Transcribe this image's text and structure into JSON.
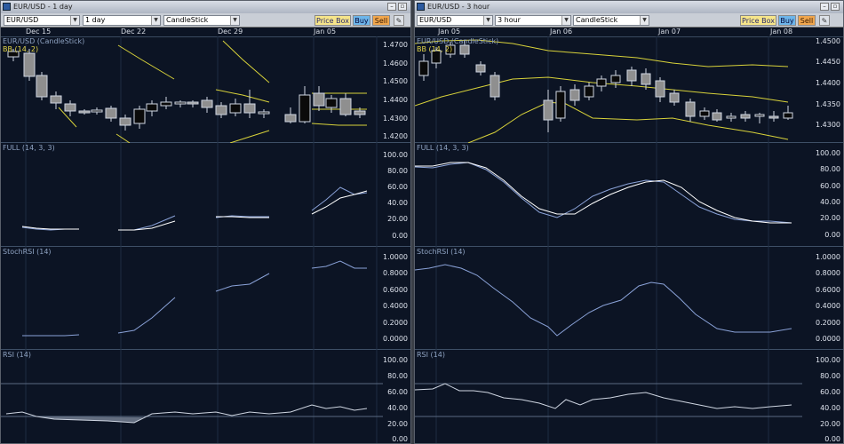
{
  "windows": [
    {
      "title": "EUR/USD - 1 day",
      "symbol": "EUR/USD",
      "period": "1 day",
      "style": "CandleStick",
      "price_box": "Price Box",
      "buy": "Buy",
      "sell": "Sell",
      "dates": [
        "Dec 15",
        "Dec 22",
        "Dec 29",
        "Jan 05"
      ],
      "price_label": "EUR/USD (CandleStick)",
      "bb_label": "BB (14, 2)",
      "price_ticks": [
        "1.4700",
        "1.4600",
        "1.4500",
        "1.4400",
        "1.4300",
        "1.4200"
      ],
      "full_label": "FULL (14, 3, 3)",
      "full_ticks": [
        "100.00",
        "80.00",
        "60.00",
        "40.00",
        "20.00",
        "0.00"
      ],
      "stochrsi_label": "StochRSI (14)",
      "stochrsi_ticks": [
        "1.0000",
        "0.8000",
        "0.6000",
        "0.4000",
        "0.2000",
        "0.0000"
      ],
      "rsi_label": "RSI (14)",
      "rsi_ticks": [
        "100.00",
        "80.00",
        "60.00",
        "40.00",
        "20.00",
        "0.00"
      ]
    },
    {
      "title": "EUR/USD - 3 hour",
      "symbol": "EUR/USD",
      "period": "3 hour",
      "style": "CandleStick",
      "price_box": "Price Box",
      "buy": "Buy",
      "sell": "Sell",
      "dates": [
        "Jan 05",
        "Jan 06",
        "Jan 07",
        "Jan 08"
      ],
      "price_label": "EUR/USD (CandleStick)",
      "bb_label": "BB (14, 2)",
      "price_ticks": [
        "1.4500",
        "1.4450",
        "1.4400",
        "1.4350",
        "1.4300"
      ],
      "full_label": "FULL (14, 3, 3)",
      "full_ticks": [
        "100.00",
        "80.00",
        "60.00",
        "40.00",
        "20.00",
        "0.00"
      ],
      "stochrsi_label": "StochRSI (14)",
      "stochrsi_ticks": [
        "1.0000",
        "0.8000",
        "0.6000",
        "0.4000",
        "0.2000",
        "0.0000"
      ],
      "rsi_label": "RSI (14)",
      "rsi_ticks": [
        "100.00",
        "80.00",
        "60.00",
        "40.00",
        "20.00",
        "0.00"
      ]
    }
  ],
  "colors": {
    "background": "#0c1424",
    "bollinger": "#d8d23a",
    "oscillator_fast": "#ffffff",
    "oscillator_slow": "#8aa2d8",
    "candle_up": "#0a0a0a",
    "candle_down": "#8f8f8f"
  }
}
